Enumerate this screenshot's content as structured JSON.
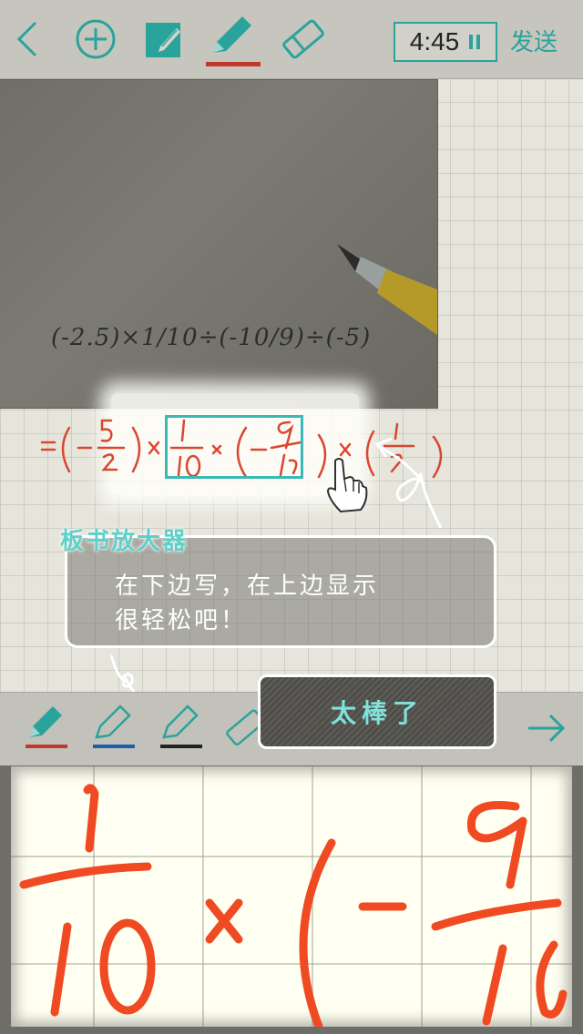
{
  "toolbar": {
    "timer": "4:45",
    "send_label": "发送",
    "accent_color": "#2aa39c",
    "pen_underline_color": "#c0392b"
  },
  "photo": {
    "expression": "(-2.5)×1/10÷(-10/9)÷(-5)"
  },
  "tip": {
    "title": "板书放大器",
    "line1": "在下边写，在上边显示",
    "line2": "很轻松吧！"
  },
  "panel": {
    "nice_button": "太棒了",
    "pens": [
      {
        "name": "red-pen",
        "color": "#c0392b",
        "selected": true
      },
      {
        "name": "blue-pen",
        "color": "#1e5fa8",
        "selected": false
      },
      {
        "name": "black-pen",
        "color": "#222222",
        "selected": false
      }
    ]
  },
  "icons": [
    "back-icon",
    "add-icon",
    "edit-icon",
    "pen-icon",
    "eraser-icon",
    "pause-icon",
    "arrow-right-icon",
    "hand-pointer-icon"
  ]
}
